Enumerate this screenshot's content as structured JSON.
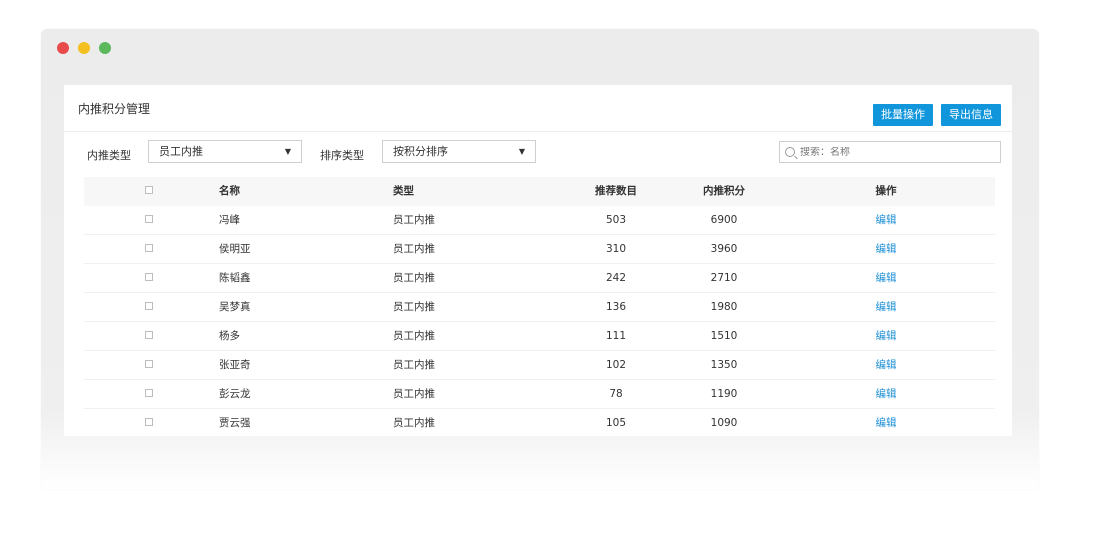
{
  "panel": {
    "title": "内推积分管理",
    "batch_button": "批量操作",
    "export_button": "导出信息"
  },
  "filters": {
    "referral_type_label": "内推类型",
    "referral_type_value": "员工内推",
    "sort_type_label": "排序类型",
    "sort_type_value": "按积分排序",
    "search_placeholder": "搜索：名称"
  },
  "table": {
    "headers": {
      "name": "名称",
      "type": "类型",
      "count": "推荐数目",
      "points": "内推积分",
      "action": "操作"
    },
    "rows": [
      {
        "name": "冯峰",
        "type": "员工内推",
        "count": "503",
        "points": "6900",
        "action": "编辑"
      },
      {
        "name": "侯明亚",
        "type": "员工内推",
        "count": "310",
        "points": "3960",
        "action": "编辑"
      },
      {
        "name": "陈韬鑫",
        "type": "员工内推",
        "count": "242",
        "points": "2710",
        "action": "编辑"
      },
      {
        "name": "吴梦真",
        "type": "员工内推",
        "count": "136",
        "points": "1980",
        "action": "编辑"
      },
      {
        "name": "杨多",
        "type": "员工内推",
        "count": "111",
        "points": "1510",
        "action": "编辑"
      },
      {
        "name": "张亚奇",
        "type": "员工内推",
        "count": "102",
        "points": "1350",
        "action": "编辑"
      },
      {
        "name": "彭云龙",
        "type": "员工内推",
        "count": "78",
        "points": "1190",
        "action": "编辑"
      },
      {
        "name": "贾云强",
        "type": "员工内推",
        "count": "105",
        "points": "1090",
        "action": "编辑"
      }
    ]
  },
  "colors": {
    "accent": "#1296db",
    "link": "#1e90d6",
    "dot_red": "#e94b4b",
    "dot_yellow": "#f3c020",
    "dot_green": "#5cb85c"
  },
  "icons": {
    "dropdown": "caret-down-icon",
    "search": "search-icon"
  }
}
